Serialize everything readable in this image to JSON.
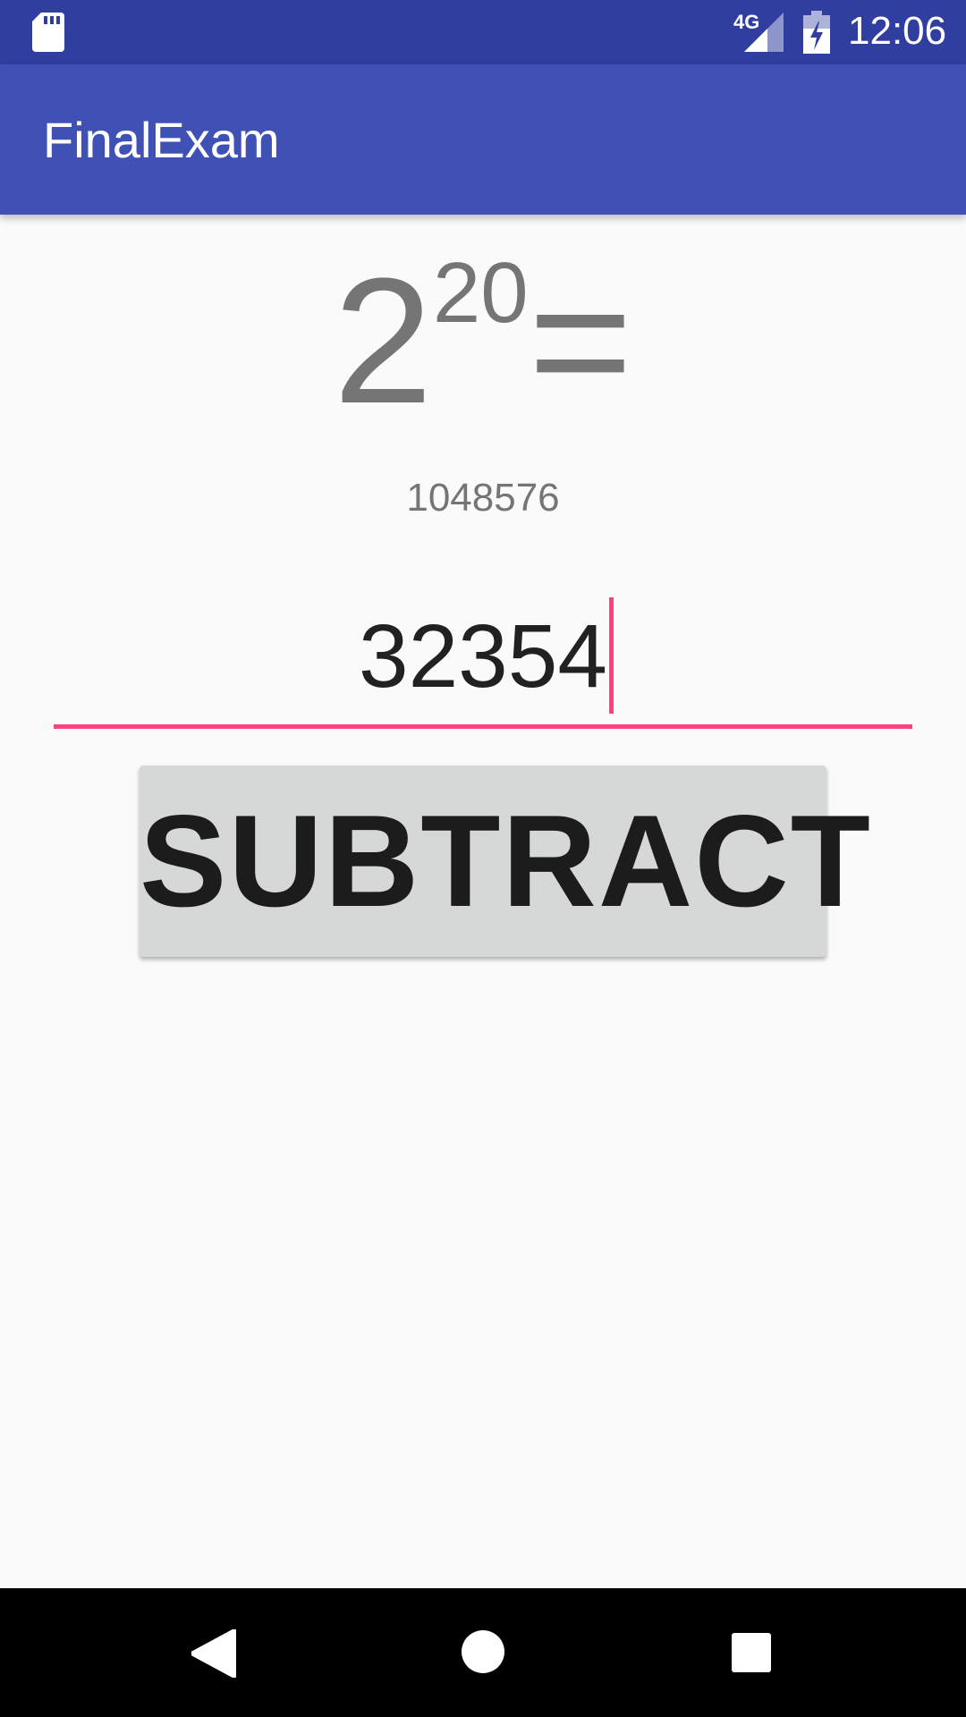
{
  "status_bar": {
    "network": "4G",
    "time": "12:06",
    "icons": [
      "sd-card-icon",
      "signal-icon",
      "battery-charging-icon"
    ],
    "background_color": "#303f9f"
  },
  "app_bar": {
    "title": "FinalExam",
    "background_color": "#3f51b5"
  },
  "main": {
    "equation": {
      "base": "2",
      "exponent": "20",
      "sign": "="
    },
    "result": "1048576",
    "input": {
      "value": "32354",
      "accent_color": "#ff4081"
    },
    "subtract_button": {
      "label": "SUBTRACT"
    }
  },
  "nav_bar": {
    "icons": [
      "back-icon",
      "home-icon",
      "recents-icon"
    ]
  }
}
